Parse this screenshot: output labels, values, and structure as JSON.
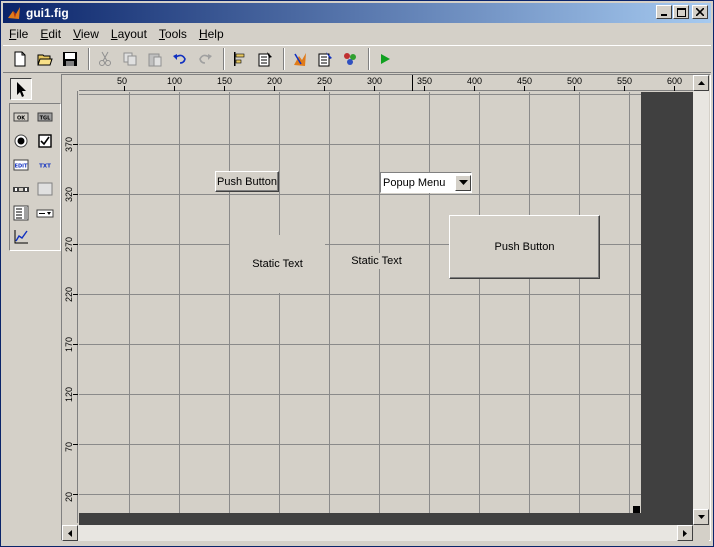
{
  "window": {
    "title": "gui1.fig",
    "buttons": [
      "minimize-icon",
      "maximize-icon",
      "close-icon"
    ]
  },
  "menu": [
    {
      "label": "File",
      "mnemonic": "F",
      "rest": "ile"
    },
    {
      "label": "Edit",
      "mnemonic": "E",
      "rest": "dit"
    },
    {
      "label": "View",
      "mnemonic": "V",
      "rest": "iew"
    },
    {
      "label": "Layout",
      "mnemonic": "L",
      "rest": "ayout"
    },
    {
      "label": "Tools",
      "mnemonic": "T",
      "rest": "ools"
    },
    {
      "label": "Help",
      "mnemonic": "H",
      "rest": "elp"
    }
  ],
  "toolbar": {
    "buttons": [
      "new-file-icon",
      "open-folder-icon",
      "save-icon",
      "cut-icon",
      "copy-icon",
      "paste-icon",
      "undo-icon",
      "redo-icon",
      "align-objects-icon",
      "menu-editor-icon",
      "property-inspector-icon",
      "m-file-editor-icon",
      "object-browser-icon",
      "run-icon"
    ]
  },
  "palette": {
    "select_tool": "arrow-select-icon",
    "components": [
      {
        "name": "pushbutton-tool",
        "glyph": "OK"
      },
      {
        "name": "toggle-button-tool",
        "glyph": "TGL"
      },
      {
        "name": "radio-button-tool",
        "glyph": ""
      },
      {
        "name": "checkbox-tool",
        "glyph": ""
      },
      {
        "name": "edit-text-tool",
        "glyph": "EDIT"
      },
      {
        "name": "static-text-tool",
        "glyph": "TXT"
      },
      {
        "name": "slider-tool",
        "glyph": ""
      },
      {
        "name": "frame-tool",
        "glyph": ""
      },
      {
        "name": "listbox-tool",
        "glyph": ""
      },
      {
        "name": "popup-menu-tool",
        "glyph": ""
      },
      {
        "name": "axes-tool",
        "glyph": ""
      }
    ]
  },
  "ruler": {
    "top_labels": [
      "50",
      "100",
      "150",
      "200",
      "250",
      "300",
      "350",
      "400",
      "450",
      "500",
      "550",
      "600"
    ],
    "left_labels": [
      "370",
      "320",
      "270",
      "220",
      "170",
      "120",
      "70",
      "20"
    ]
  },
  "canvas": {
    "pushbutton_small": "Push Button",
    "popup_menu": "Popup Menu",
    "static_text_1": "Static Text",
    "static_text_2": "Static Text",
    "pushbutton_large": "Push Button"
  }
}
